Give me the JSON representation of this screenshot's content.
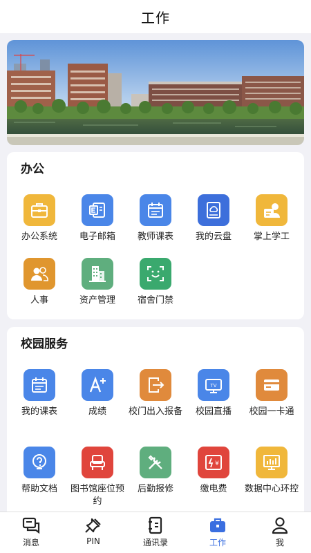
{
  "header": {
    "title": "工作"
  },
  "banner": {
    "icon": "campus-photo"
  },
  "office": {
    "title": "办公",
    "items": [
      {
        "label": "办公系统",
        "icon": "briefcase-icon",
        "color": "#f0b73b"
      },
      {
        "label": "电子邮箱",
        "icon": "email-icon",
        "color": "#4a86e8"
      },
      {
        "label": "教师课表",
        "icon": "calendar-icon",
        "color": "#4a86e8"
      },
      {
        "label": "我的云盘",
        "icon": "cloud-disk-icon",
        "color": "#3d6fdb"
      },
      {
        "label": "掌上学工",
        "icon": "student-work-icon",
        "color": "#f0b73b"
      },
      {
        "label": "人事",
        "icon": "people-icon",
        "color": "#e0962e"
      },
      {
        "label": "资产管理",
        "icon": "building-icon",
        "color": "#5fae7e"
      },
      {
        "label": "宿舍门禁",
        "icon": "face-scan-icon",
        "color": "#3aa96e"
      }
    ]
  },
  "campus": {
    "title": "校园服务",
    "items": [
      {
        "label": "我的课表",
        "icon": "calendar-icon",
        "color": "#4a86e8"
      },
      {
        "label": "成绩",
        "icon": "grade-icon",
        "color": "#4a86e8"
      },
      {
        "label": "校门出入报备",
        "icon": "gate-exit-icon",
        "color": "#e08a3c"
      },
      {
        "label": "校园直播",
        "icon": "tv-icon",
        "color": "#4a86e8"
      },
      {
        "label": "校园一卡通",
        "icon": "card-icon",
        "color": "#e08a3c"
      },
      {
        "label": "帮助文档",
        "icon": "help-icon",
        "color": "#4a86e8"
      },
      {
        "label": "图书馆座位预约",
        "icon": "seat-icon",
        "color": "#e0453c"
      },
      {
        "label": "后勤报修",
        "icon": "repair-icon",
        "color": "#5fae7e"
      },
      {
        "label": "缴电费",
        "icon": "electric-bill-icon",
        "color": "#e0453c"
      },
      {
        "label": "数据中心环控",
        "icon": "data-center-icon",
        "color": "#f0b73b"
      }
    ]
  },
  "tabbar": {
    "items": [
      {
        "label": "消息",
        "icon": "message-icon",
        "active": false
      },
      {
        "label": "PIN",
        "icon": "pin-icon",
        "active": false
      },
      {
        "label": "通讯录",
        "icon": "contacts-icon",
        "active": false
      },
      {
        "label": "工作",
        "icon": "work-icon",
        "active": true
      },
      {
        "label": "我",
        "icon": "user-icon",
        "active": false
      }
    ],
    "active_color": "#3b6fe0"
  }
}
